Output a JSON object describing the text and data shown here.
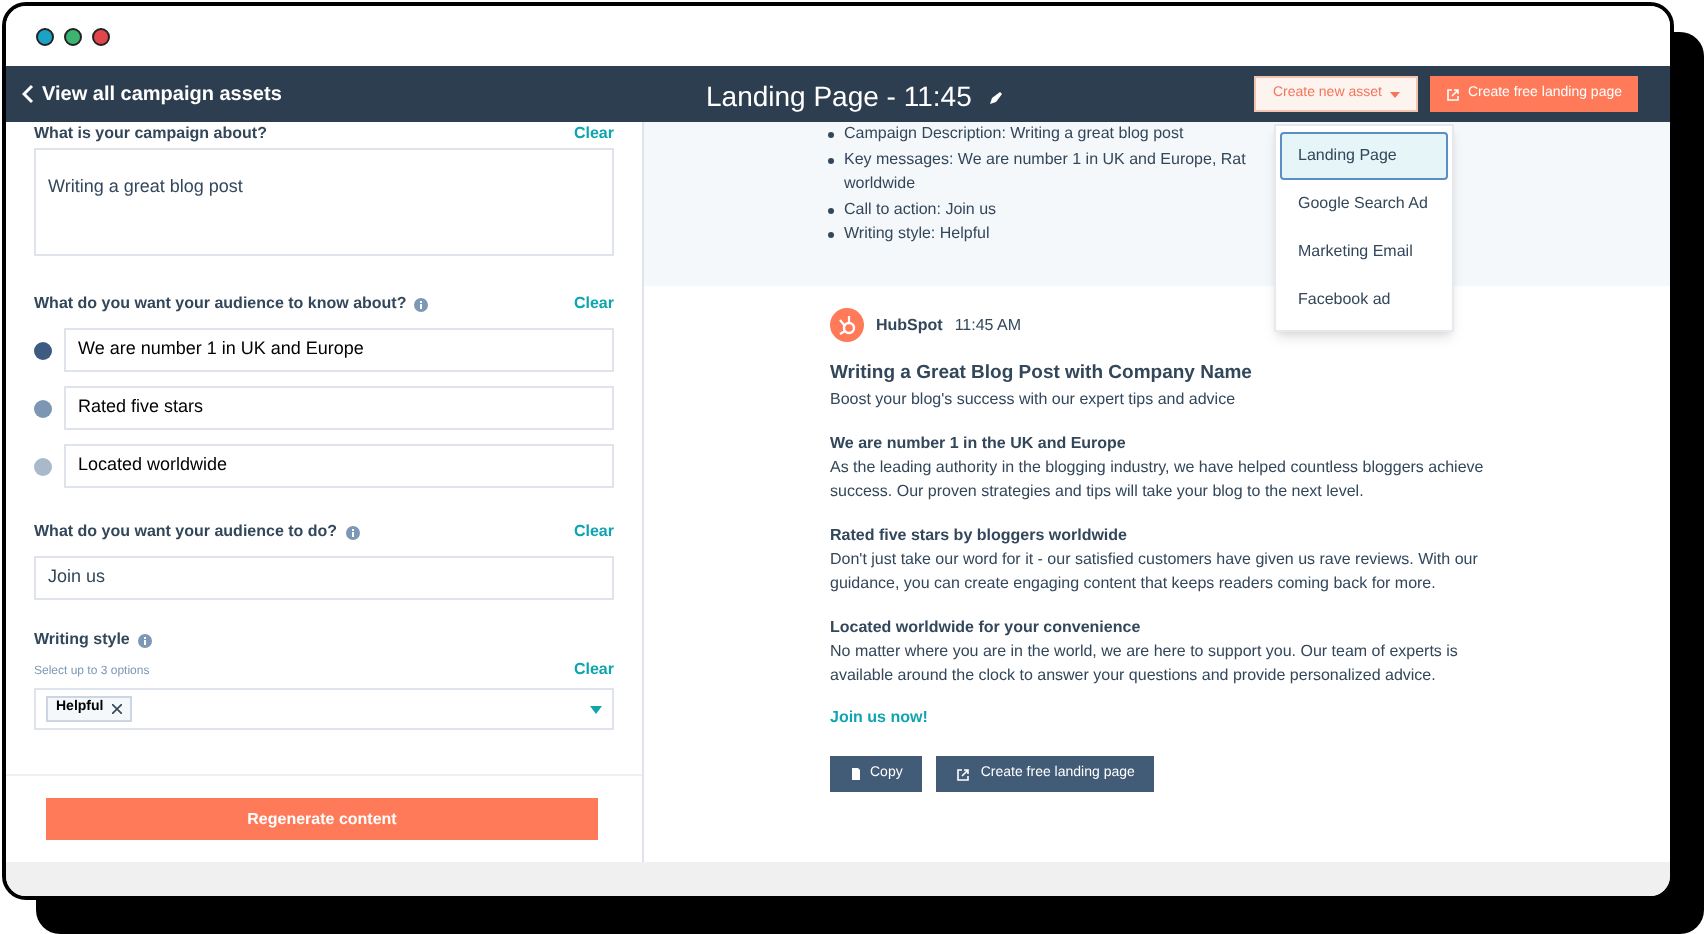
{
  "window": {
    "dots": [
      {
        "color": "#1ba3c6"
      },
      {
        "color": "#3cb371"
      },
      {
        "color": "#e0474c"
      }
    ]
  },
  "navbar": {
    "back": "View all campaign assets",
    "title": "Landing Page - 11:45",
    "create_asset": "Create new asset",
    "create_page": "Create free landing page"
  },
  "dropdown": [
    {
      "label": "Landing Page",
      "selected": true
    },
    {
      "label": "Google Search Ad",
      "selected": false
    },
    {
      "label": "Marketing Email",
      "selected": false
    },
    {
      "label": "Facebook ad",
      "selected": false
    }
  ],
  "form": {
    "about_label": "What is your campaign about?",
    "about_clear": "Clear",
    "about_value": "Writing a great blog post",
    "know_label": "What do you want your audience to know about?",
    "know_clear": "Clear",
    "messages": [
      {
        "text": "We are number 1 in UK and Europe",
        "color": "#3d5a80"
      },
      {
        "text": "Rated five stars",
        "color": "#7d96b3"
      },
      {
        "text": "Located worldwide",
        "color": "#a9b9cc"
      }
    ],
    "do_label": "What do you want your audience to do?",
    "do_clear": "Clear",
    "do_value": "Join us",
    "style_label": "Writing style",
    "style_hint": "Select up to 3 options",
    "style_clear": "Clear",
    "style_tags": [
      "Helpful"
    ],
    "regenerate": "Regenerate content"
  },
  "summary": [
    "Campaign Description: Writing a great blog post",
    [
      "Key messages: We are number 1 in UK and Europe, Rat",
      "worldwide"
    ],
    "Call to action: Join us",
    "Writing style: Helpful"
  ],
  "message": {
    "sender": "HubSpot",
    "time": "11:45 AM",
    "title": "Writing a Great Blog Post with Company Name",
    "subtitle": "Boost your blog's success with our expert tips and advice",
    "sections": [
      {
        "heading": "We are number 1 in the UK and Europe",
        "body": "As the leading authority in the blogging industry, we have helped countless bloggers achieve success. Our proven strategies and tips will take your blog to the next level."
      },
      {
        "heading": "Rated five stars by bloggers worldwide",
        "body": "Don't just take our word for it - our satisfied customers have given us rave reviews. With our guidance, you can create engaging content that keeps readers coming back for more."
      },
      {
        "heading": "Located worldwide for your convenience",
        "body": "No matter where you are in the world, we are here to support you. Our team of experts is available around the clock to answer your questions and provide personalized advice."
      }
    ],
    "cta": "Join us now!",
    "copy": "Copy",
    "create_page": "Create free landing page"
  }
}
